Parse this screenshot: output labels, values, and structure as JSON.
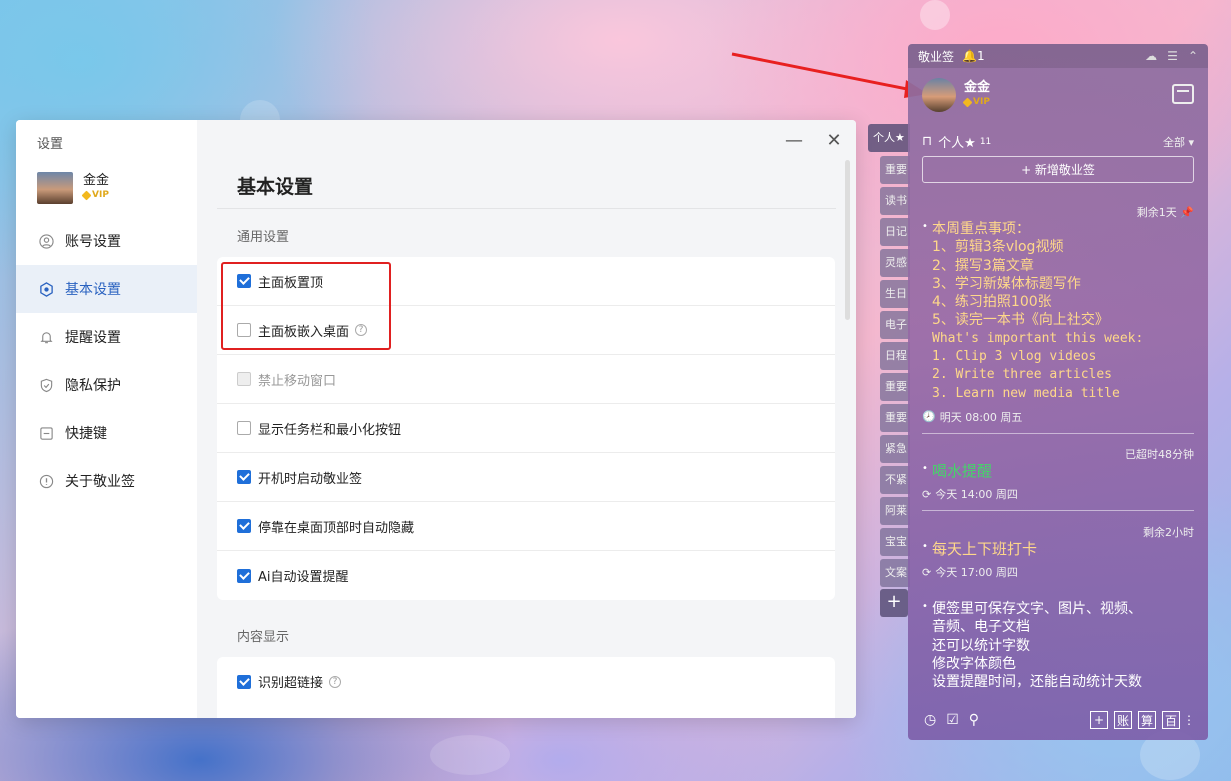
{
  "settings": {
    "window_title": "设置",
    "user_name": "金金",
    "vip": "VIP",
    "nav": [
      {
        "label": "账号设置",
        "icon": "user-icon"
      },
      {
        "label": "基本设置",
        "icon": "settings-icon"
      },
      {
        "label": "提醒设置",
        "icon": "bell-icon"
      },
      {
        "label": "隐私保护",
        "icon": "shield-icon"
      },
      {
        "label": "快捷键",
        "icon": "keyboard-icon"
      },
      {
        "label": "关于敬业签",
        "icon": "info-icon"
      }
    ],
    "heading": "基本设置",
    "section_general": "通用设置",
    "general_options": [
      {
        "label": "主面板置顶",
        "checked": true
      },
      {
        "label": "主面板嵌入桌面",
        "checked": false,
        "help": "?"
      },
      {
        "label": "禁止移动窗口",
        "checked": false,
        "disabled": true
      },
      {
        "label": "显示任务栏和最小化按钮",
        "checked": false
      },
      {
        "label": "开机时启动敬业签",
        "checked": true
      },
      {
        "label": "停靠在桌面顶部时自动隐藏",
        "checked": true
      },
      {
        "label": "Ai自动设置提醒",
        "checked": true
      }
    ],
    "section_content": "内容显示",
    "content_options": [
      {
        "label": "识别超链接",
        "checked": true,
        "help": "?"
      }
    ]
  },
  "tabs": [
    "个人★",
    "重要",
    "读书",
    "日记",
    "灵感",
    "生日",
    "电子",
    "日程",
    "重要",
    "重要",
    "紧急",
    "不紧",
    "阿莱",
    "宝宝",
    "文案"
  ],
  "tab_add": "+",
  "panel": {
    "app_name": "敬业签",
    "notif_count": "1",
    "user_name": "金金",
    "vip": "VIP",
    "category": "个人★",
    "category_count": "11",
    "filter": "全部",
    "new_button": "+ 新增敬业签",
    "notes": [
      {
        "status": "剩余1天",
        "lines": [
          "本周重点事项：",
          "1、剪辑3条vlog视频",
          "2、撰写3篇文章",
          "3、学习新媒体标题写作",
          "4、练习拍照100张",
          "5、读完一本书《向上社交》"
        ],
        "en_lines": [
          "What's important this week:",
          "1. Clip 3 vlog videos",
          "2. Write three articles",
          "3. Learn new media title"
        ],
        "when": "明天 08:00 周五"
      },
      {
        "status": "已超时48分钟",
        "text": "喝水提醒",
        "when": "今天 14:00 周四"
      },
      {
        "status": "剩余2小时",
        "text": "每天上下班打卡",
        "when": "今天 17:00 周四"
      },
      {
        "lines": [
          "便签里可保存文字、图片、视频、",
          "音频、电子文档",
          "还可以统计字数",
          "修改字体颜色",
          "设置提醒时间，还能自动统计天数"
        ]
      }
    ],
    "bottom_tools": [
      "+",
      "账",
      "算",
      "百"
    ]
  }
}
